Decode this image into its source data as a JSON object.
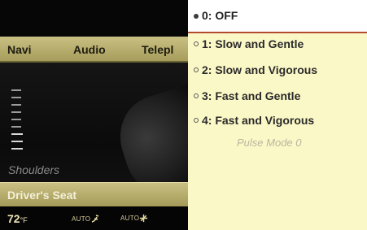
{
  "menu": {
    "items": [
      "Navi",
      "Audio",
      "Telepl"
    ]
  },
  "content": {
    "zone_label": "Shoulders"
  },
  "footer": {
    "label": "Driver's Seat"
  },
  "status": {
    "temperature": "72",
    "temperature_unit": "°F",
    "auto_airflow": "AUTO",
    "auto_fan": "AUTO"
  },
  "dropdown": {
    "selected": "0: OFF",
    "options": [
      "1: Slow and Gentle",
      "2: Slow and Vigorous",
      "3: Fast and Gentle",
      "4: Fast and Vigorous"
    ],
    "pulse_mode": "Pulse Mode   0"
  },
  "colors": {
    "menu_bar": "#b8ae6c",
    "dropdown_bg": "#fbf8c7",
    "selected_underline": "#b44a2d"
  }
}
